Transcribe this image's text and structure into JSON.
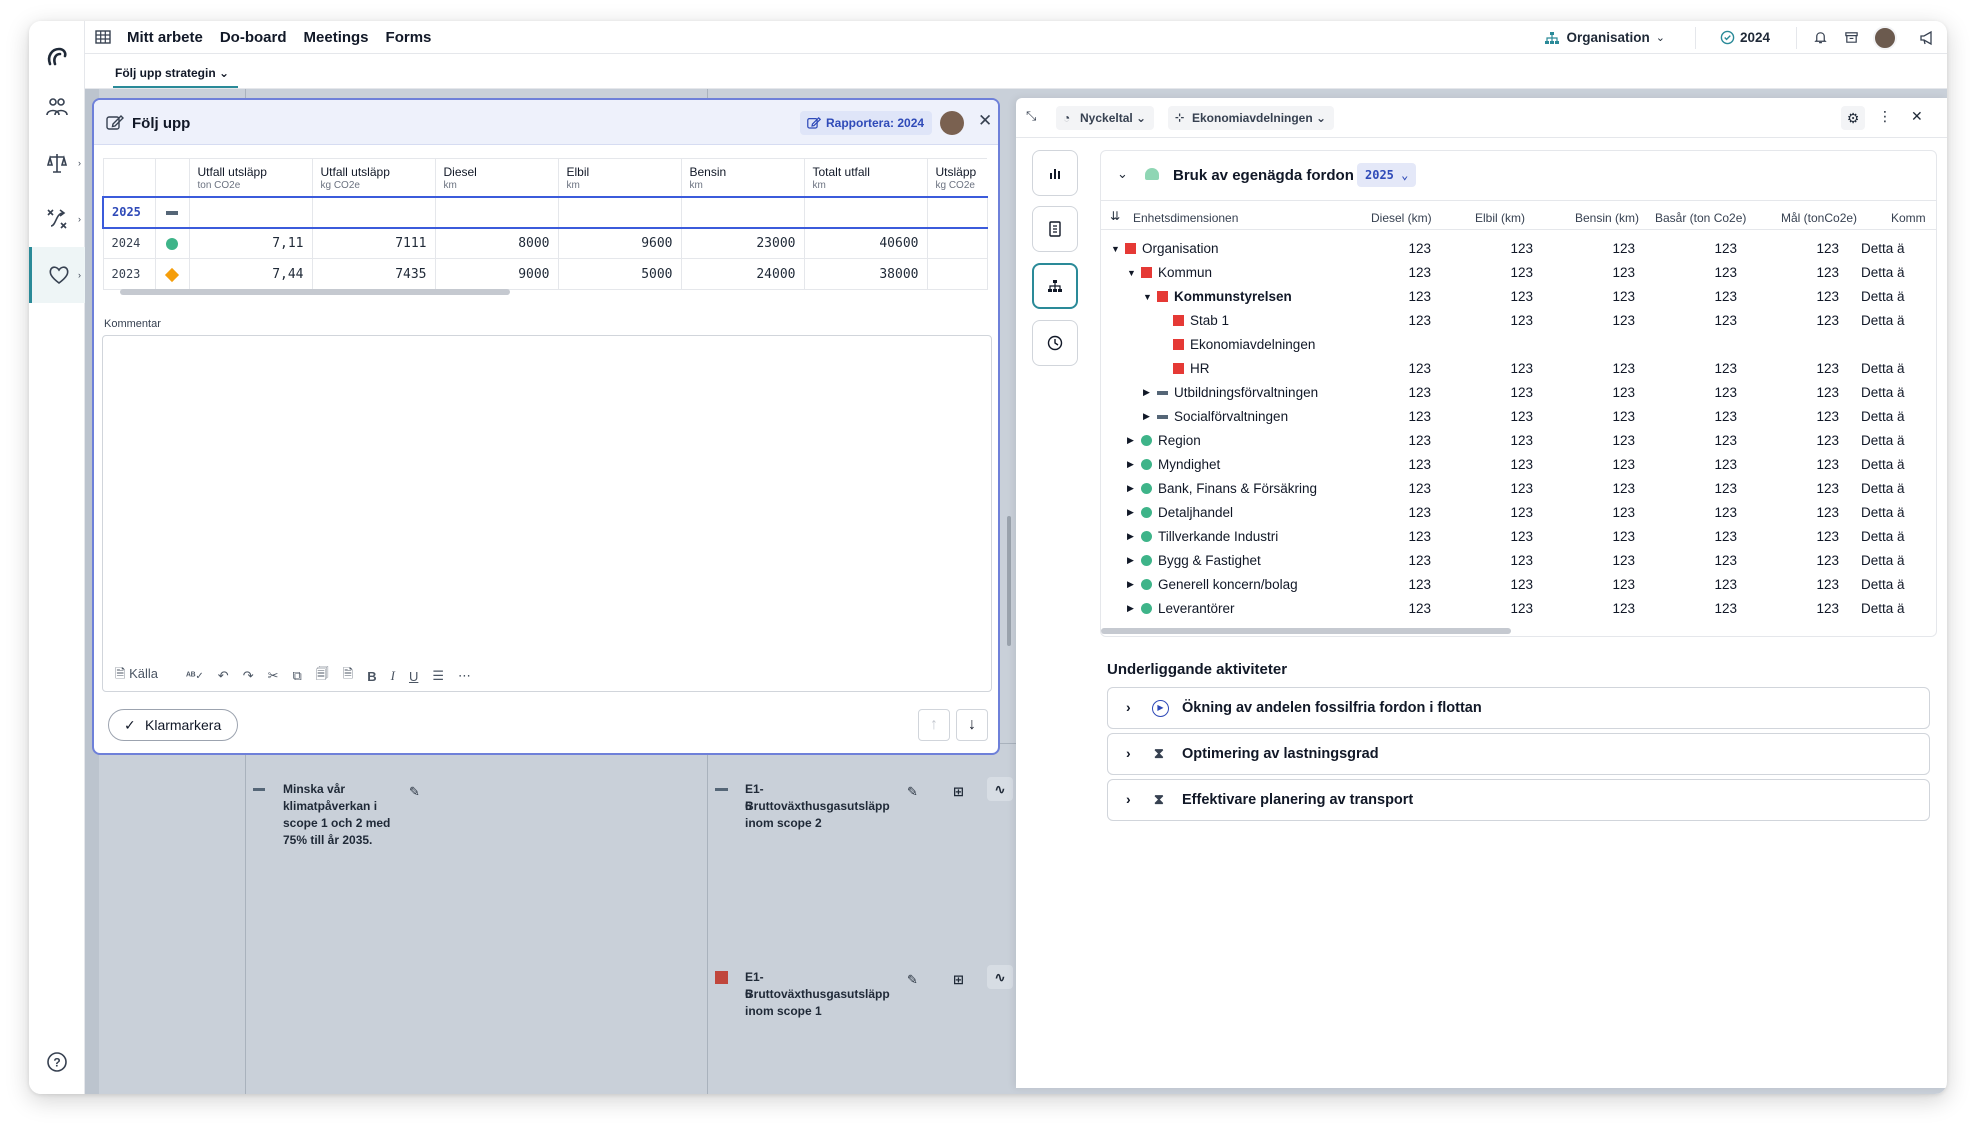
{
  "topnav": {
    "items": [
      "Mitt arbete",
      "Do-board",
      "Meetings",
      "Forms"
    ],
    "org_label": "Organisation",
    "year_label": "2024"
  },
  "subnav": {
    "tab_label": "Följ upp strategin"
  },
  "background_cards": [
    {
      "text": "Minska vår klimatpåverkan i scope 1 och 2 med 75% till år 2035."
    },
    {
      "code": "E1-6",
      "text": "Bruttoväxthusgasutsläpp inom scope 2"
    },
    {
      "code": "E1-6",
      "text": "Bruttoväxthusgasutsläpp inom scope 1"
    }
  ],
  "follow_up": {
    "title": "Följ upp",
    "report_label": "Rapportera: 2024",
    "columns": [
      {
        "label": "Utfall utsläpp",
        "unit": "ton CO2e"
      },
      {
        "label": "Utfall utsläpp",
        "unit": "kg CO2e"
      },
      {
        "label": "Diesel",
        "unit": "km"
      },
      {
        "label": "Elbil",
        "unit": "km"
      },
      {
        "label": "Bensin",
        "unit": "km"
      },
      {
        "label": "Totalt utfall",
        "unit": "km"
      },
      {
        "label": "Utsläpp",
        "unit": "kg CO2e"
      }
    ],
    "rows": [
      {
        "year": "2025",
        "status": "none",
        "values": [
          "",
          "",
          "",
          "",
          "",
          "",
          ""
        ]
      },
      {
        "year": "2024",
        "status": "green",
        "values": [
          "7,11",
          "7111",
          "8000",
          "9600",
          "23000",
          "40600",
          ""
        ]
      },
      {
        "year": "2023",
        "status": "orange",
        "values": [
          "7,44",
          "7435",
          "9000",
          "5000",
          "24000",
          "38000",
          ""
        ]
      }
    ],
    "comment_label": "Kommentar",
    "toolbar_source": "Källa",
    "mark_done_label": "Klarmarkera"
  },
  "panel": {
    "chip_kpi": "Nyckeltal",
    "chip_unit": "Ekonomiavdelningen",
    "title": "Bruk av egenägda fordon",
    "year_select": "2025",
    "dimension_header": "Enhetsdimensionen",
    "columns": [
      "Diesel (km)",
      "Elbil (km)",
      "Bensin (km)",
      "Basår (ton Co2e)",
      "Mål (tonCo2e)",
      "Komm"
    ],
    "tree": [
      {
        "label": "Organisation",
        "level": 0,
        "marker": "red",
        "exp": "open",
        "bold": false,
        "values": [
          "123",
          "123",
          "123",
          "123",
          "123",
          "Detta ä"
        ]
      },
      {
        "label": "Kommun",
        "level": 1,
        "marker": "red",
        "exp": "open",
        "bold": false,
        "values": [
          "123",
          "123",
          "123",
          "123",
          "123",
          "Detta ä"
        ]
      },
      {
        "label": "Kommunstyrelsen",
        "level": 2,
        "marker": "red",
        "exp": "open",
        "bold": true,
        "values": [
          "123",
          "123",
          "123",
          "123",
          "123",
          "Detta ä"
        ]
      },
      {
        "label": "Stab 1",
        "level": 3,
        "marker": "red",
        "exp": "",
        "bold": false,
        "values": [
          "123",
          "123",
          "123",
          "123",
          "123",
          "Detta ä"
        ]
      },
      {
        "label": "Ekonomiavdelningen",
        "level": 3,
        "marker": "red",
        "exp": "",
        "bold": false,
        "values": [
          "",
          "",
          "",
          "",
          "",
          ""
        ]
      },
      {
        "label": "HR",
        "level": 3,
        "marker": "red",
        "exp": "",
        "bold": false,
        "values": [
          "123",
          "123",
          "123",
          "123",
          "123",
          "Detta ä"
        ]
      },
      {
        "label": "Utbildningsförvaltningen",
        "level": 2,
        "marker": "dash",
        "exp": "closed",
        "bold": false,
        "values": [
          "123",
          "123",
          "123",
          "123",
          "123",
          "Detta ä"
        ]
      },
      {
        "label": "Socialförvaltningen",
        "level": 2,
        "marker": "dash",
        "exp": "closed",
        "bold": false,
        "values": [
          "123",
          "123",
          "123",
          "123",
          "123",
          "Detta ä"
        ]
      },
      {
        "label": "Region",
        "level": 1,
        "marker": "green",
        "exp": "closed",
        "bold": false,
        "values": [
          "123",
          "123",
          "123",
          "123",
          "123",
          "Detta ä"
        ]
      },
      {
        "label": "Myndighet",
        "level": 1,
        "marker": "green",
        "exp": "closed",
        "bold": false,
        "values": [
          "123",
          "123",
          "123",
          "123",
          "123",
          "Detta ä"
        ]
      },
      {
        "label": "Bank, Finans & Försäkring",
        "level": 1,
        "marker": "green",
        "exp": "closed",
        "bold": false,
        "values": [
          "123",
          "123",
          "123",
          "123",
          "123",
          "Detta ä"
        ]
      },
      {
        "label": "Detaljhandel",
        "level": 1,
        "marker": "green",
        "exp": "closed",
        "bold": false,
        "values": [
          "123",
          "123",
          "123",
          "123",
          "123",
          "Detta ä"
        ]
      },
      {
        "label": "Tillverkande Industri",
        "level": 1,
        "marker": "green",
        "exp": "closed",
        "bold": false,
        "values": [
          "123",
          "123",
          "123",
          "123",
          "123",
          "Detta ä"
        ]
      },
      {
        "label": "Bygg & Fastighet",
        "level": 1,
        "marker": "green",
        "exp": "closed",
        "bold": false,
        "values": [
          "123",
          "123",
          "123",
          "123",
          "123",
          "Detta ä"
        ]
      },
      {
        "label": "Generell koncern/bolag",
        "level": 1,
        "marker": "green",
        "exp": "closed",
        "bold": false,
        "values": [
          "123",
          "123",
          "123",
          "123",
          "123",
          "Detta ä"
        ]
      },
      {
        "label": "Leverantörer",
        "level": 1,
        "marker": "green",
        "exp": "closed",
        "bold": false,
        "values": [
          "123",
          "123",
          "123",
          "123",
          "123",
          "Detta ä"
        ]
      }
    ],
    "activities_title": "Underliggande aktiviteter",
    "activities": [
      {
        "label": "Ökning av andelen fossilfria fordon i flottan",
        "icon": "play-circle-icon"
      },
      {
        "label": "Optimering av lastningsgrad",
        "icon": "hourglass-icon"
      },
      {
        "label": "Effektivare planering av transport",
        "icon": "hourglass-icon"
      }
    ]
  },
  "colors": {
    "accent": "#2a8a98",
    "modal_border": "#6e80d9",
    "green": "#3eb489",
    "red": "#e53935",
    "orange": "#f59e0b"
  }
}
